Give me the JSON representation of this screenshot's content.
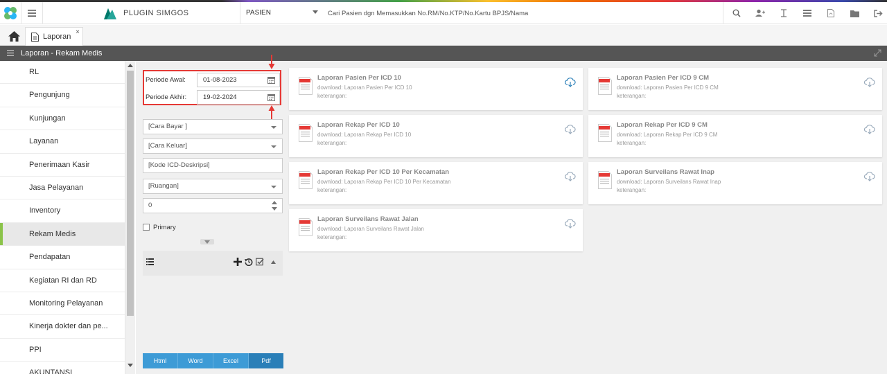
{
  "app": {
    "brand": "PLUGIN SIMGOS",
    "search_category": "PASIEN",
    "search_placeholder": "Cari Pasien dgn Memasukkan No.RM/No.KTP/No.Kartu BPJS/Nama",
    "top_icons": [
      "search-icon",
      "user-add-icon",
      "text-cursor-icon",
      "list-icon",
      "pdf-file-icon",
      "folder-icon",
      "logout-icon"
    ]
  },
  "tabs": [
    {
      "label": "Laporan",
      "close": "×"
    }
  ],
  "section": {
    "title": "Laporan - Rekam Medis"
  },
  "sidebar": {
    "items": [
      {
        "label": "RL"
      },
      {
        "label": "Pengunjung"
      },
      {
        "label": "Kunjungan"
      },
      {
        "label": "Layanan"
      },
      {
        "label": "Penerimaan Kasir"
      },
      {
        "label": "Jasa Pelayanan"
      },
      {
        "label": "Inventory"
      },
      {
        "label": "Rekam Medis",
        "active": true
      },
      {
        "label": "Pendapatan"
      },
      {
        "label": "Kegiatan RI dan RD"
      },
      {
        "label": "Monitoring Pelayanan"
      },
      {
        "label": "Kinerja dokter dan pe..."
      },
      {
        "label": "PPI"
      },
      {
        "label": "AKUNTANSI"
      }
    ]
  },
  "filters": {
    "periode_awal_label": "Periode Awal:",
    "periode_awal_value": "01-08-2023",
    "periode_akhir_label": "Periode Akhir:",
    "periode_akhir_value": "19-02-2024",
    "cara_bayar": "[Cara Bayar ]",
    "cara_keluar": "[Cara Keluar]",
    "kode_icd": "[Kode ICD-Deskripsi]",
    "ruangan": "[Ruangan]",
    "number_value": "0",
    "primary_label": "Primary",
    "highlight_color": "#e53935"
  },
  "export": {
    "buttons": [
      "Html",
      "Word",
      "Excel",
      "Pdf"
    ],
    "selected": "Pdf",
    "accent": "#3d9bd6"
  },
  "reports": [
    {
      "title": "Laporan Pasien Per ICD 10",
      "download": "download: Laporan Pasien Per ICD 10",
      "ket": "keterangan:"
    },
    {
      "title": "Laporan Pasien Per ICD 9 CM",
      "download": "download: Laporan Pasien Per ICD 9 CM",
      "ket": "keterangan:"
    },
    {
      "title": "Laporan Rekap Per ICD 10",
      "download": "download: Laporan Rekap Per ICD 10",
      "ket": "keterangan:"
    },
    {
      "title": "Laporan Rekap Per ICD 9 CM",
      "download": "download: Laporan Rekap Per ICD 9 CM",
      "ket": "keterangan:"
    },
    {
      "title": "Laporan Rekap Per ICD 10 Per Kecamatan",
      "download": "download: Laporan Rekap Per ICD 10 Per Kecamatan",
      "ket": "keterangan:"
    },
    {
      "title": "Laporan Surveilans Rawat Inap",
      "download": "download: Laporan Surveilans Rawat Inap",
      "ket": "keterangan:"
    },
    {
      "title": "Laporan Surveilans Rawat Jalan",
      "download": "download: Laporan Surveilans Rawat Jalan",
      "ket": "keterangan:"
    }
  ]
}
